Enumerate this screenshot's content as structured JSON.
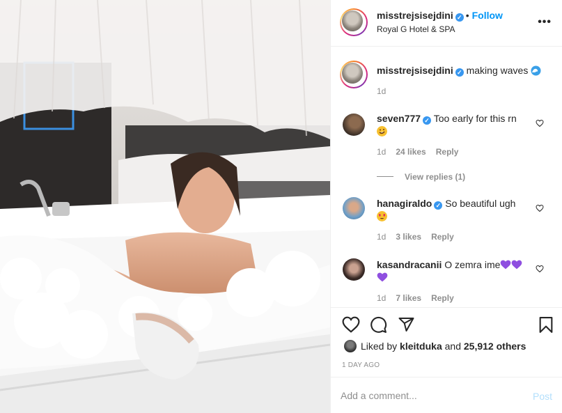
{
  "post": {
    "username": "misstrejsisejdini",
    "follow_label": "Follow",
    "location": "Royal G Hotel & SPA"
  },
  "caption": {
    "username": "misstrejsisejdini",
    "text": "making waves",
    "emoji": "wave-emoji",
    "time": "1d"
  },
  "comments": [
    {
      "username": "seven777",
      "verified": true,
      "text": "Too early for this rn",
      "emoji": "rolling-laughing-emoji",
      "time": "1d",
      "likes": "24 likes",
      "reply_label": "Reply",
      "view_replies": "View replies (1)"
    },
    {
      "username": "hanagiraldo",
      "verified": true,
      "text": "So beautiful ugh",
      "emoji": "heart-eyes-emoji",
      "time": "1d",
      "likes": "3 likes",
      "reply_label": "Reply"
    },
    {
      "username": "kasandracanii",
      "verified": false,
      "text": "O zemra ime",
      "emoji": "purple-heart-emoji",
      "time": "1d",
      "likes": "7 likes",
      "reply_label": "Reply"
    }
  ],
  "likes": {
    "prefix": "Liked by",
    "user": "kleitduka",
    "middle": "and",
    "count": "25,912 others"
  },
  "timestamp": "1 DAY AGO",
  "add_comment": {
    "placeholder": "Add a comment...",
    "post_label": "Post"
  },
  "colors": {
    "link_blue": "#0095f6",
    "verified_blue": "#3897f0",
    "muted_gray": "#8e8e8e",
    "text": "#262626"
  }
}
